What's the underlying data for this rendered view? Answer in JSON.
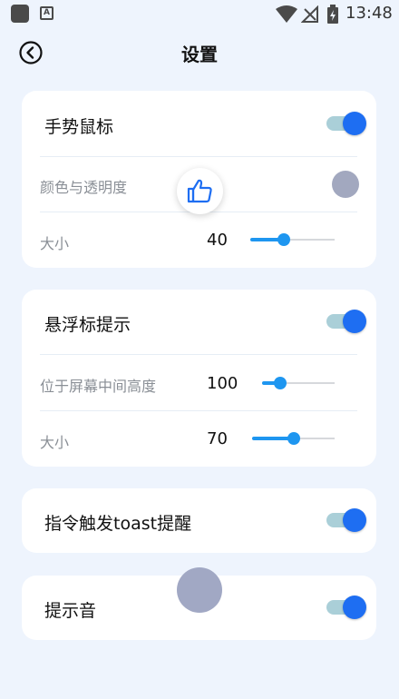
{
  "status_bar": {
    "time": "13:48",
    "a_icon_letter": "A",
    "icons": [
      "app-icon",
      "a-icon",
      "wifi-icon",
      "no-signal-icon",
      "battery-charging-icon"
    ]
  },
  "header": {
    "title": "设置",
    "back_icon": "back-circle-icon"
  },
  "cards": {
    "gesture_mouse": {
      "title": "手势鼠标",
      "enabled": true,
      "color_label": "颜色与透明度",
      "color_value": "#a2a8bf",
      "size_label": "大小",
      "size_value": "40",
      "size_fraction": 0.4
    },
    "float_hint": {
      "title": "悬浮标提示",
      "enabled": true,
      "height_label": "位于屏幕中间高度",
      "height_value": "100",
      "height_fraction": 0.25,
      "size_label": "大小",
      "size_value": "70",
      "size_fraction": 0.5
    },
    "toast_hint": {
      "title": "指令触发toast提醒",
      "enabled": true
    },
    "sound_hint": {
      "title": "提示音",
      "enabled": true
    }
  },
  "overlays": {
    "thumb_icon": "thumbs-up-icon",
    "float_ball_color": "#a1a8c4"
  },
  "colors": {
    "accent": "#1e6ef2",
    "slider": "#1e96f0",
    "toggle_track": "#aacfd8",
    "background": "#eef4fd"
  }
}
